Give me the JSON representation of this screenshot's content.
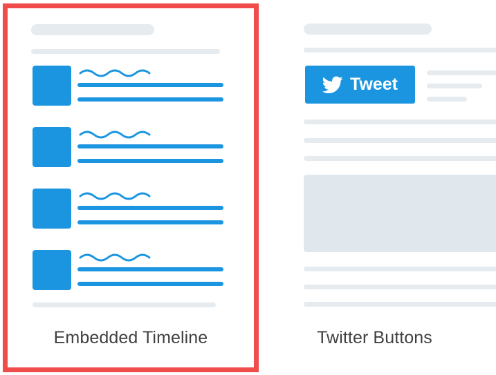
{
  "options": [
    {
      "caption": "Embedded Timeline",
      "selected": true
    },
    {
      "caption": "Twitter Buttons",
      "selected": false
    }
  ],
  "tweet_button": {
    "label": "Tweet",
    "icon": "twitter-bird-icon"
  },
  "colors": {
    "accent": "#1b95e0",
    "selection_border": "#f04c4c",
    "placeholder": "#e6ebef",
    "caption_text": "#404040"
  }
}
